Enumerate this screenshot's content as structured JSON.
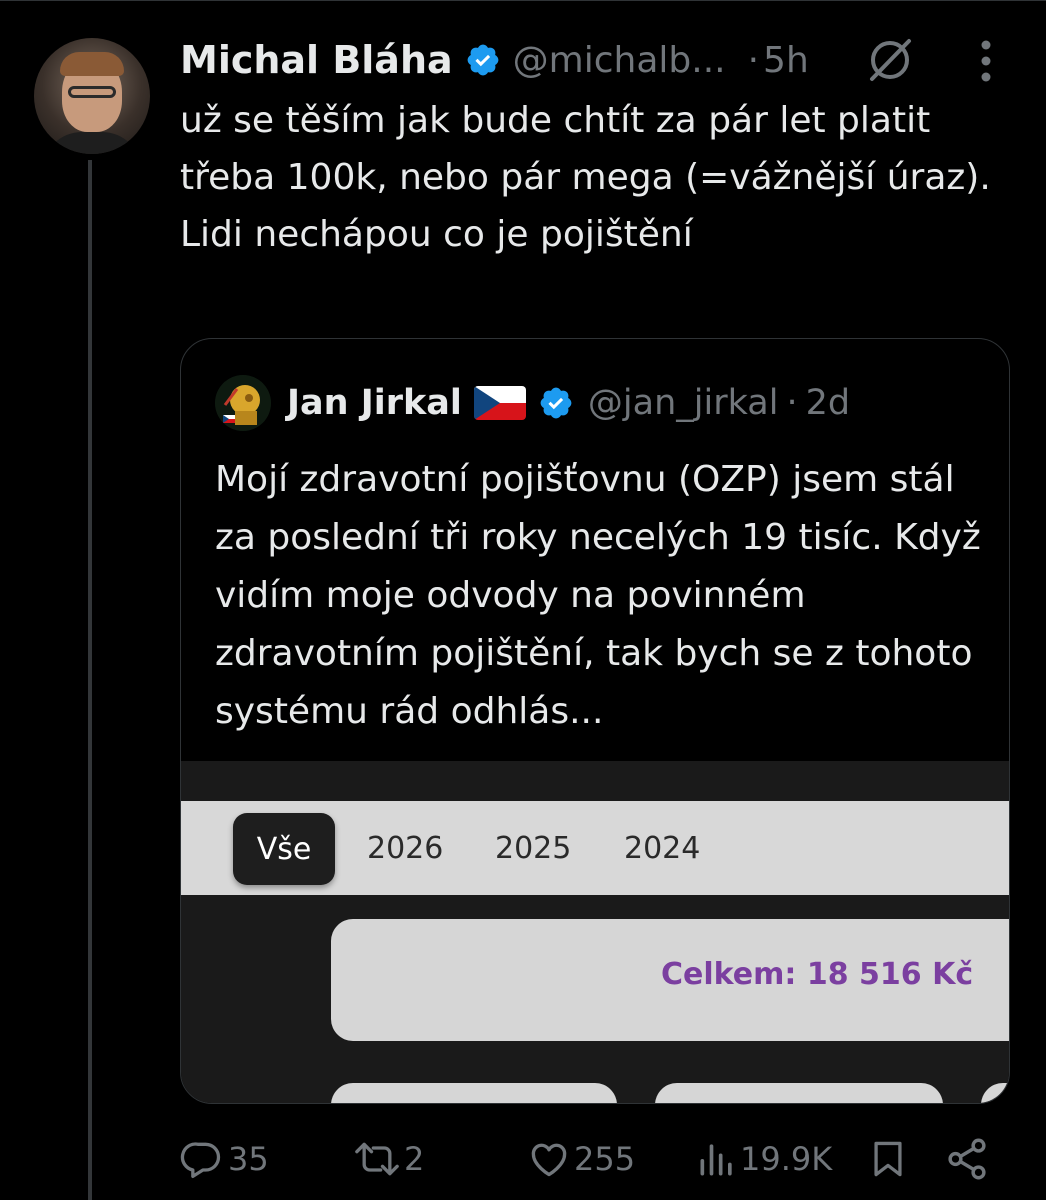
{
  "tweet": {
    "author_name": "Michal Bláha",
    "author_handle": "@michalb...",
    "separator": "·",
    "time": "5h",
    "text_lines": [
      "už se těším jak bude chtít za pár let platit třeba 100k, nebo pár mega (=vážnější úraz).",
      "Lidi nechápou co je pojištění"
    ]
  },
  "quote": {
    "author_name": "Jan Jirkal",
    "flag": "🇨🇿",
    "author_handle": "@jan_jirkal",
    "separator": "·",
    "time": "2d",
    "text": "Mojí zdravotní pojišťovnu (OZP) jsem stál za poslední tři roky necelých 19 tisíc. Když vidím moje odvody na povinném zdravotním pojištění, tak bych se z tohoto systému rád odhlás...",
    "media": {
      "tabs": [
        "Vše",
        "2026",
        "2025",
        "2024"
      ],
      "active_tab": "Vše",
      "total_label": "Celkem: 18 516 Kč",
      "accent_color": "#7b3fa0"
    }
  },
  "actions": {
    "replies": "35",
    "reposts": "2",
    "likes": "255",
    "views": "19.9K"
  },
  "colors": {
    "background": "#000000",
    "text": "#e7e9ea",
    "muted": "#71767b",
    "verified": "#1d9bf0",
    "border": "#2f3336"
  },
  "icons": [
    "verified-badge-icon",
    "grok-icon",
    "more-icon",
    "reply-icon",
    "repost-icon",
    "like-icon",
    "views-icon",
    "bookmark-icon",
    "share-icon"
  ]
}
